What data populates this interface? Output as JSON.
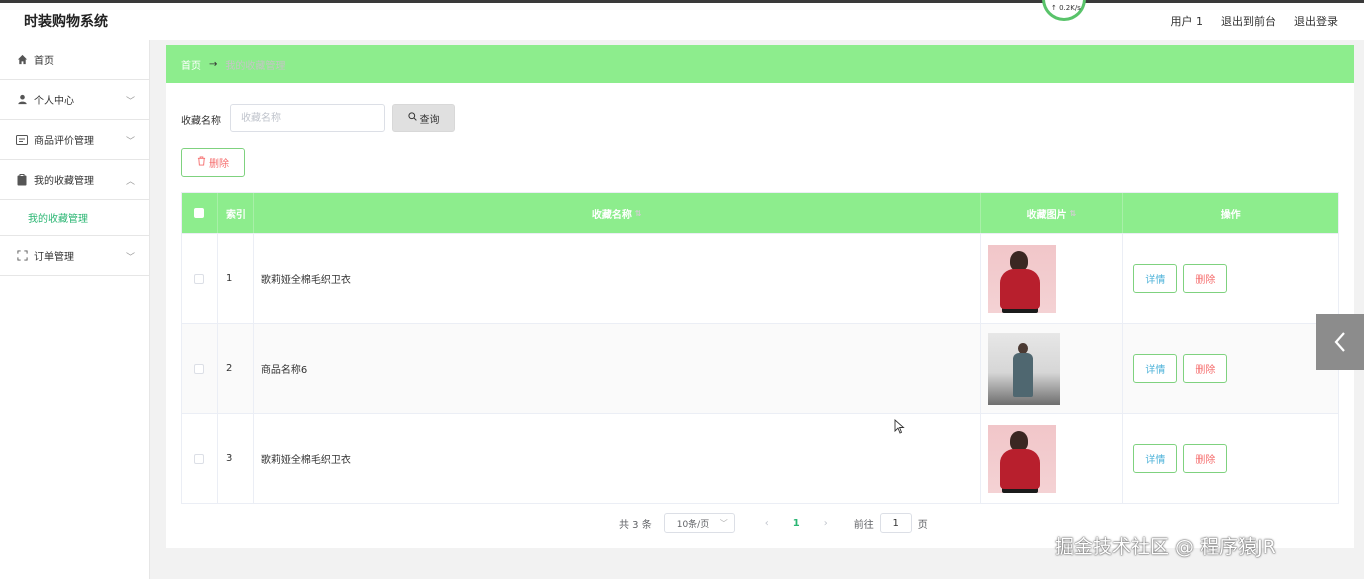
{
  "app": {
    "title": "时装购物系统",
    "speed": "↑ 0.2K/s"
  },
  "header": {
    "links": [
      "用户 1",
      "退出到前台",
      "退出登录"
    ]
  },
  "sidebar": {
    "items": [
      {
        "label": "首页",
        "icon": "home-icon"
      },
      {
        "label": "个人中心",
        "icon": "user-icon"
      },
      {
        "label": "商品评价管理",
        "icon": "card-icon"
      },
      {
        "label": "我的收藏管理",
        "icon": "clipboard-icon"
      },
      {
        "label": "订单管理",
        "icon": "frame-icon"
      }
    ],
    "submenu": {
      "label": "我的收藏管理"
    }
  },
  "breadcrumb": {
    "home": "首页",
    "separator": "→",
    "current": "我的收藏管理"
  },
  "search": {
    "label": "收藏名称",
    "placeholder": "收藏名称",
    "value": "",
    "button": "查询"
  },
  "toolbar": {
    "delete_label": "删除"
  },
  "table": {
    "headers": {
      "index": "索引",
      "name": "收藏名称",
      "image": "收藏图片",
      "actions": "操作"
    },
    "rows": [
      {
        "index": "1",
        "name": "歌莉娅全棉毛织卫衣",
        "detail": "详情",
        "delete": "删除"
      },
      {
        "index": "2",
        "name": "商品名称6",
        "detail": "详情",
        "delete": "删除"
      },
      {
        "index": "3",
        "name": "歌莉娅全棉毛织卫衣",
        "detail": "详情",
        "delete": "删除"
      }
    ]
  },
  "pagination": {
    "total": "共 3 条",
    "page_size": "10条/页",
    "current_page": "1",
    "goto_prefix": "前往",
    "goto_value": "1",
    "goto_suffix": "页"
  },
  "watermark": "掘金技术社区 @ 程序猿JR",
  "colors": {
    "accent": "#8ded8d",
    "active_text": "#2bb673",
    "danger": "#f56c6c",
    "info": "#4fb3d9"
  }
}
